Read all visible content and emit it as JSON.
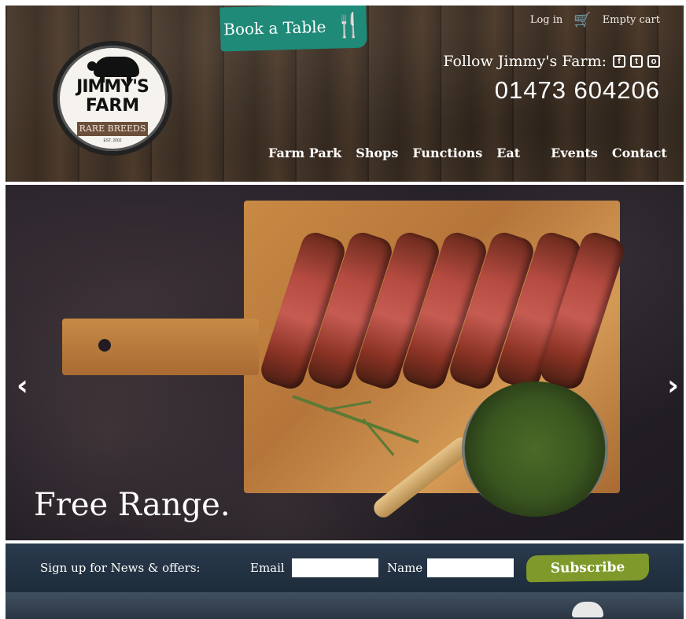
{
  "header": {
    "book_table": "Book a Table",
    "login": "Log in",
    "cart": "Empty cart",
    "follow": "Follow Jimmy's Farm:",
    "phone": "01473 604206",
    "social": [
      "f",
      "t",
      "o"
    ],
    "nav": [
      "Farm Park",
      "Shops",
      "Functions",
      "Eat",
      "Events",
      "Contact"
    ]
  },
  "logo": {
    "line1": "JIMMY'S",
    "line2": "FARM",
    "band": "RARE BREEDS",
    "small": "EST. 2002"
  },
  "hero": {
    "caption": "Free Range.",
    "prev": "‹",
    "next": "›"
  },
  "signup": {
    "label": "Sign up for News & offers:",
    "email_label": "Email",
    "name_label": "Name",
    "email_value": "",
    "name_value": "",
    "button": "Subscribe"
  },
  "colors": {
    "book_button": "#1f8a78",
    "subscribe_button": "#7f9a2a",
    "signup_bar": "#2a3a4d"
  }
}
